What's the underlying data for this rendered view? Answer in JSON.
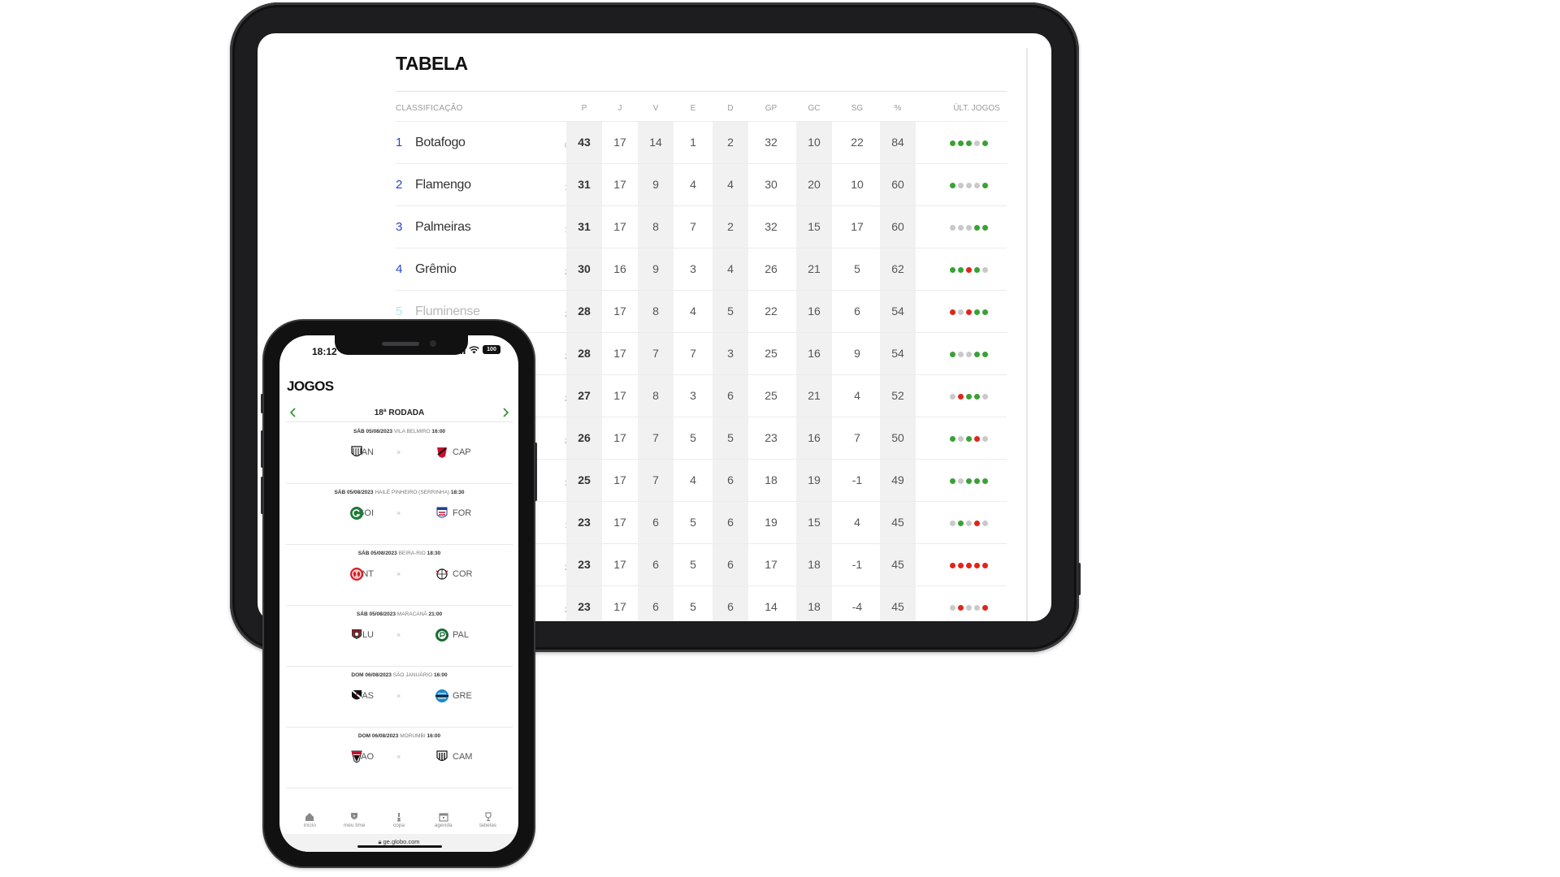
{
  "tablet": {
    "title": "TABELA",
    "columns": [
      "CLASSIFICAÇÃO",
      "P",
      "J",
      "V",
      "E",
      "D",
      "GP",
      "GC",
      "SG",
      "%",
      "ÚLT. JOGOS"
    ],
    "colors": {
      "win": "#3aa135",
      "loss": "#e0251b",
      "draw": "#c9c9c9",
      "up": "#3aa135",
      "down": "#e0251b",
      "same": "#bbbbbb",
      "pos_blue": "#2646c9"
    },
    "rows": [
      {
        "pos": "1",
        "team": "Botafogo",
        "var": "0",
        "trend": "same",
        "p": "43",
        "j": "17",
        "v": "14",
        "e": "1",
        "d": "2",
        "gp": "32",
        "gc": "10",
        "sg": "22",
        "pct": "84",
        "last": [
          "win",
          "win",
          "win",
          "draw",
          "win"
        ]
      },
      {
        "pos": "2",
        "team": "Flamengo",
        "var": "1",
        "trend": "up",
        "p": "31",
        "j": "17",
        "v": "9",
        "e": "4",
        "d": "4",
        "gp": "30",
        "gc": "20",
        "sg": "10",
        "pct": "60",
        "last": [
          "win",
          "draw",
          "draw",
          "draw",
          "win"
        ]
      },
      {
        "pos": "3",
        "team": "Palmeiras",
        "var": "1",
        "trend": "up",
        "p": "31",
        "j": "17",
        "v": "8",
        "e": "7",
        "d": "2",
        "gp": "32",
        "gc": "15",
        "sg": "17",
        "pct": "60",
        "last": [
          "draw",
          "draw",
          "draw",
          "win",
          "win"
        ]
      },
      {
        "pos": "4",
        "team": "Grêmio",
        "var": "2",
        "trend": "down",
        "p": "30",
        "j": "16",
        "v": "9",
        "e": "3",
        "d": "4",
        "gp": "26",
        "gc": "21",
        "sg": "5",
        "pct": "62",
        "last": [
          "win",
          "win",
          "loss",
          "win",
          "draw"
        ]
      },
      {
        "pos": "5",
        "team": "Fluminense",
        "var": "2",
        "trend": "up",
        "p": "28",
        "j": "17",
        "v": "8",
        "e": "4",
        "d": "5",
        "gp": "22",
        "gc": "16",
        "sg": "6",
        "pct": "54",
        "last": [
          "loss",
          "draw",
          "loss",
          "win",
          "win"
        ]
      },
      {
        "pos": "",
        "team": "",
        "var": "2",
        "trend": "up",
        "p": "28",
        "j": "17",
        "v": "7",
        "e": "7",
        "d": "3",
        "gp": "25",
        "gc": "16",
        "sg": "9",
        "pct": "54",
        "last": [
          "win",
          "draw",
          "draw",
          "win",
          "win"
        ]
      },
      {
        "pos": "",
        "team": "",
        "var": "2",
        "trend": "down",
        "p": "27",
        "j": "17",
        "v": "8",
        "e": "3",
        "d": "6",
        "gp": "25",
        "gc": "21",
        "sg": "4",
        "pct": "52",
        "last": [
          "draw",
          "loss",
          "win",
          "win",
          "draw"
        ]
      },
      {
        "pos": "",
        "team": "",
        "var": "2",
        "trend": "down",
        "p": "26",
        "j": "17",
        "v": "7",
        "e": "5",
        "d": "5",
        "gp": "23",
        "gc": "16",
        "sg": "7",
        "pct": "50",
        "last": [
          "win",
          "draw",
          "win",
          "loss",
          "draw"
        ]
      },
      {
        "pos": "",
        "team": "",
        "var": "3",
        "trend": "up",
        "p": "25",
        "j": "17",
        "v": "7",
        "e": "4",
        "d": "6",
        "gp": "18",
        "gc": "19",
        "sg": "-1",
        "pct": "49",
        "last": [
          "win",
          "draw",
          "win",
          "win",
          "win"
        ]
      },
      {
        "pos": "",
        "team": "",
        "var": "1",
        "trend": "up",
        "p": "23",
        "j": "17",
        "v": "6",
        "e": "5",
        "d": "6",
        "gp": "19",
        "gc": "15",
        "sg": "4",
        "pct": "45",
        "last": [
          "draw",
          "win",
          "draw",
          "loss",
          "draw"
        ]
      },
      {
        "pos": "",
        "team": "",
        "var": "2",
        "trend": "down",
        "p": "23",
        "j": "17",
        "v": "6",
        "e": "5",
        "d": "6",
        "gp": "17",
        "gc": "18",
        "sg": "-1",
        "pct": "45",
        "last": [
          "loss",
          "loss",
          "loss",
          "loss",
          "loss"
        ]
      },
      {
        "pos": "",
        "team": "",
        "var": "2",
        "trend": "down",
        "p": "23",
        "j": "17",
        "v": "6",
        "e": "5",
        "d": "6",
        "gp": "14",
        "gc": "18",
        "sg": "-4",
        "pct": "45",
        "last": [
          "draw",
          "loss",
          "draw",
          "draw",
          "loss"
        ]
      }
    ]
  },
  "phone": {
    "status_time": "18:12",
    "battery": "100",
    "title": "JOGOS",
    "round": "18ª RODADA",
    "vs": "×",
    "matches": [
      {
        "date": "SÁB 05/08/2023",
        "venue": "VILA BELMIRO",
        "time": "16:00",
        "home": "SAN",
        "home_crest": "santos-crest-icon",
        "away": "CAP",
        "away_crest": "athletico-crest-icon"
      },
      {
        "date": "SÁB 05/08/2023",
        "venue": "HAILÉ PINHEIRO (SERRINHA)",
        "time": "18:30",
        "home": "GOI",
        "home_crest": "goias-crest-icon",
        "away": "FOR",
        "away_crest": "fortaleza-crest-icon"
      },
      {
        "date": "SÁB 05/08/2023",
        "venue": "BEIRA-RIO",
        "time": "18:30",
        "home": "INT",
        "home_crest": "internacional-crest-icon",
        "away": "COR",
        "away_crest": "corinthians-crest-icon"
      },
      {
        "date": "SÁB 05/08/2023",
        "venue": "MARACANÃ",
        "time": "21:00",
        "home": "FLU",
        "home_crest": "fluminense-crest-icon",
        "away": "PAL",
        "away_crest": "palmeiras-crest-icon"
      },
      {
        "date": "DOM 06/08/2023",
        "venue": "SÃO JANUÁRIO",
        "time": "16:00",
        "home": "VAS",
        "home_crest": "vasco-crest-icon",
        "away": "GRE",
        "away_crest": "gremio-crest-icon"
      },
      {
        "date": "DOM 06/08/2023",
        "venue": "MORUMBI",
        "time": "16:00",
        "home": "SAO",
        "home_crest": "sao-paulo-crest-icon",
        "away": "CAM",
        "away_crest": "atletico-mg-crest-icon"
      }
    ],
    "nav": [
      {
        "label": "início",
        "icon": "home-icon"
      },
      {
        "label": "meu time",
        "icon": "shield-icon"
      },
      {
        "label": "copa",
        "icon": "trophy-icon"
      },
      {
        "label": "agenda",
        "icon": "calendar-icon"
      },
      {
        "label": "tabelas",
        "icon": "cup-icon"
      }
    ],
    "url": "ge.globo.com"
  }
}
